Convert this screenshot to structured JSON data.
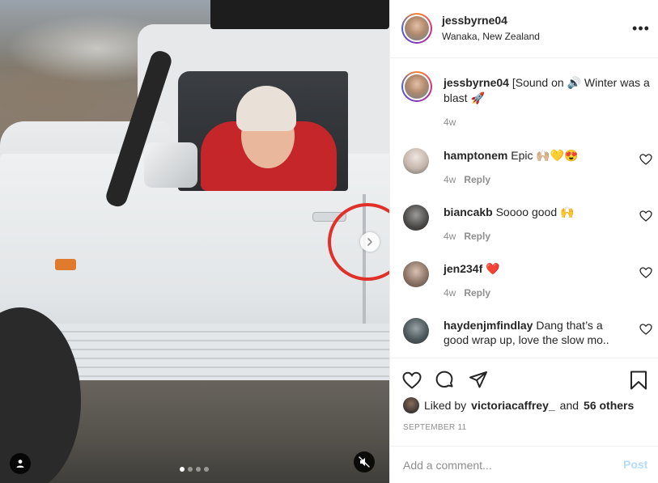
{
  "post": {
    "username": "jessbyrne04",
    "location": "Wanaka, New Zealand",
    "more_glyph": "•••"
  },
  "caption": {
    "username": "jessbyrne04",
    "text": "[Sound on 🔊 Winter was a blast 🚀",
    "time": "4w"
  },
  "comments": [
    {
      "username": "hamptonem",
      "text": "Epic 🙌🏼💛😍",
      "time": "4w",
      "reply": "Reply",
      "avatar_color": "#d8d3cf"
    },
    {
      "username": "biancakb",
      "text": "Soooo good 🙌",
      "time": "4w",
      "reply": "Reply",
      "avatar_color": "#5a5a5a"
    },
    {
      "username": "jen234f",
      "text": "❤️",
      "time": "4w",
      "reply": "Reply",
      "avatar_color": "#a89486"
    },
    {
      "username": "haydenjmfindlay",
      "text": "Dang that’s a good wrap up, love the slow mo..",
      "time": "",
      "reply": "",
      "avatar_color": "#4f5a5e"
    }
  ],
  "likes": {
    "prefix": "Liked by",
    "user": "victoriacaffrey_",
    "and": "and",
    "others": "56 others"
  },
  "date": "SEPTEMBER 11",
  "add_comment": {
    "placeholder": "Add a comment...",
    "post_label": "Post"
  },
  "carousel": {
    "current": 1,
    "total": 4
  },
  "colors": {
    "accent_ring": "#dd2a7b",
    "highlight_circle": "#e0302a",
    "post_disabled": "#b3dbff"
  }
}
